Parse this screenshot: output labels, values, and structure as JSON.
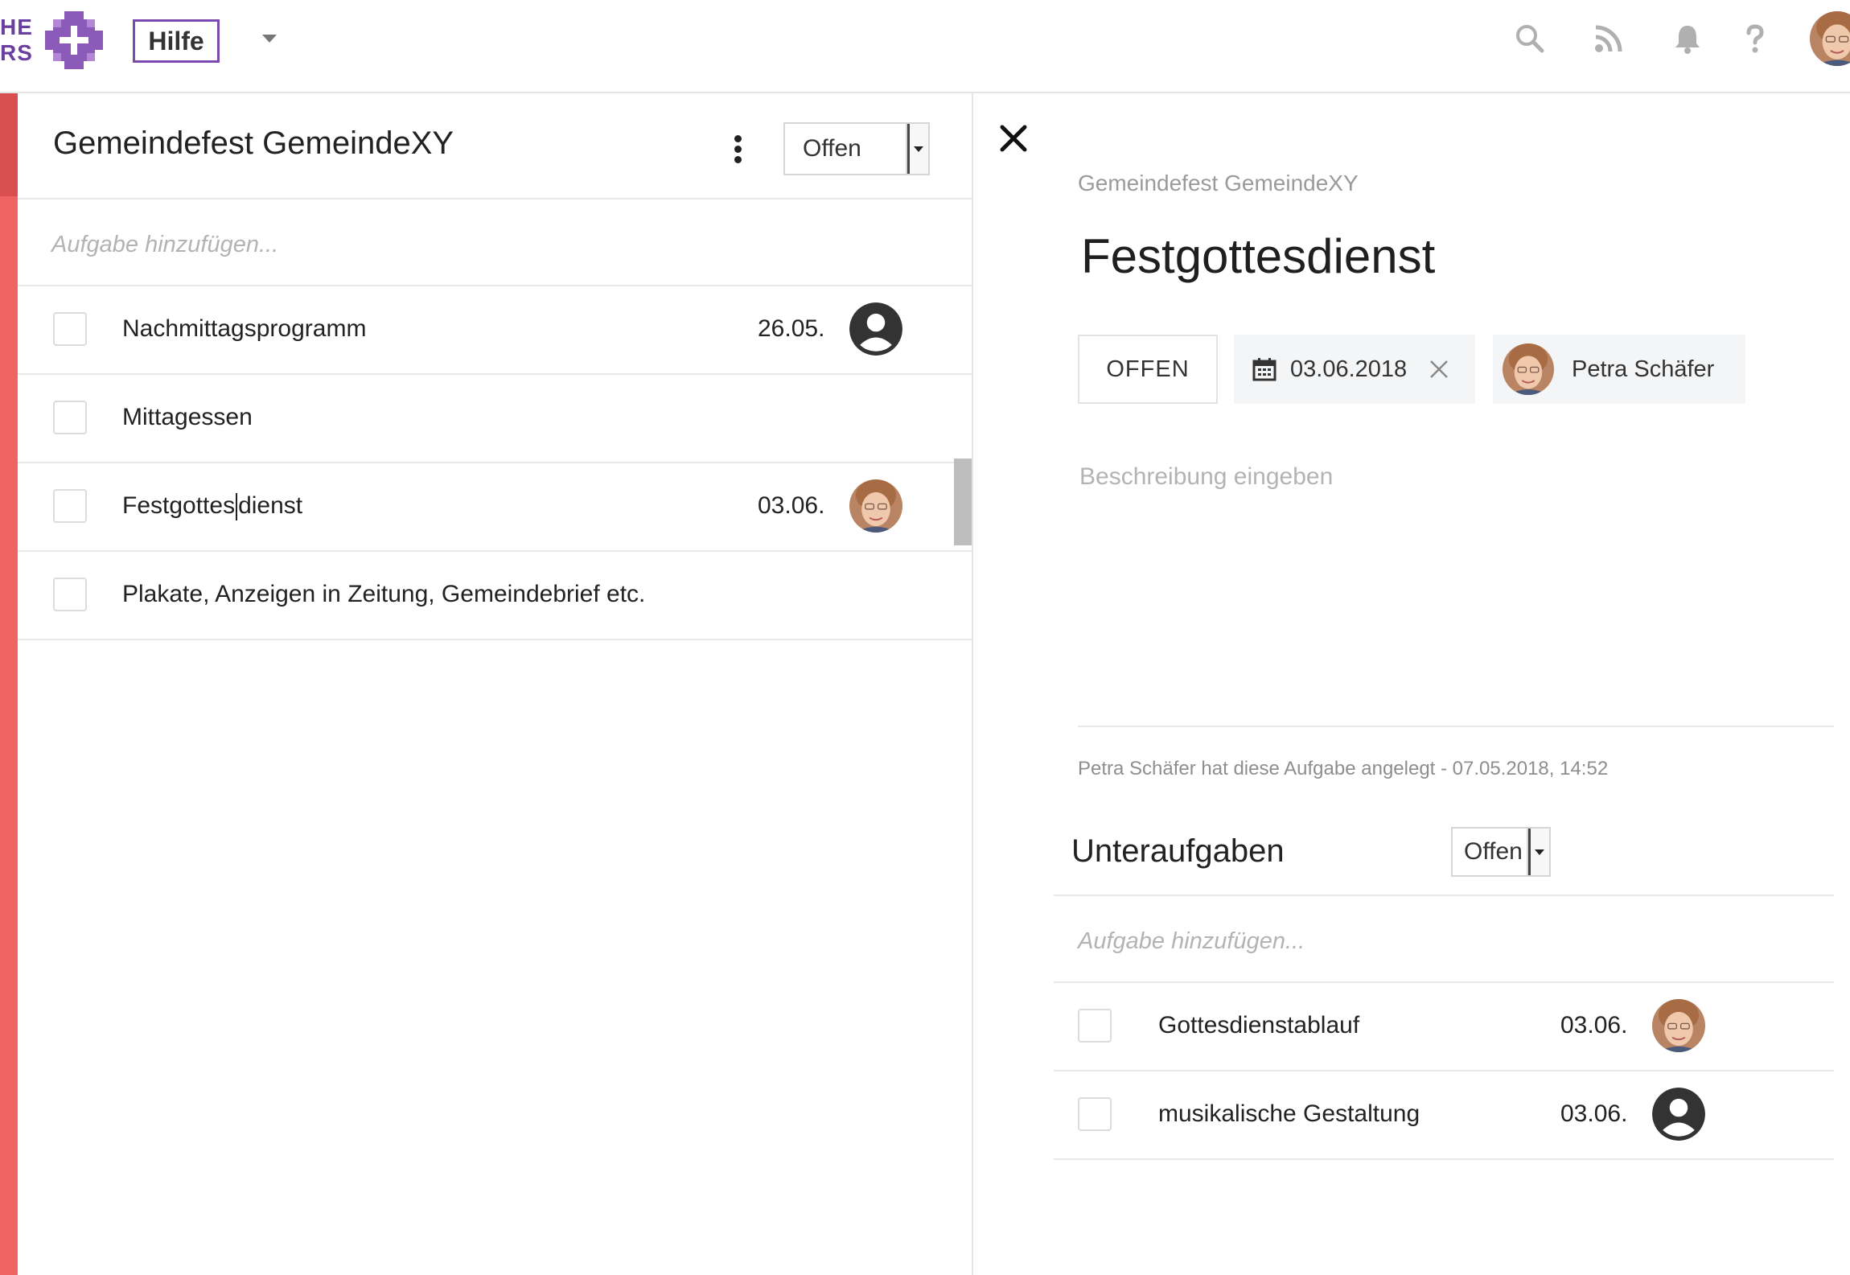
{
  "header": {
    "logo_line1": "HE",
    "logo_line2": "RS",
    "help_button": "Hilfe",
    "icons": [
      "search-icon",
      "rss-icon",
      "bell-icon",
      "help-icon"
    ],
    "brand_color": "#6a3fa0",
    "accent_color": "#f06363"
  },
  "list": {
    "title": "Gemeindefest GemeindeXY",
    "filter": "Offen",
    "add_placeholder": "Aufgabe hinzufügen...",
    "tasks": [
      {
        "label": "Nachmittagsprogramm",
        "date": "26.05.",
        "assignee": "placeholder-avatar"
      },
      {
        "label": "Mittagessen",
        "date": "",
        "assignee": ""
      },
      {
        "label_before_cursor": "Festgottes",
        "label_after_cursor": "dienst",
        "date": "03.06.",
        "assignee": "photo-avatar"
      },
      {
        "label": "Plakate, Anzeigen in Zeitung, Gemeindebrief etc.",
        "date": "",
        "assignee": ""
      }
    ]
  },
  "detail": {
    "breadcrumb": "Gemeindefest GemeindeXY",
    "title": "Festgottesdienst",
    "status": "OFFEN",
    "due_date": "03.06.2018",
    "assignee": "Petra Schäfer",
    "description_placeholder": "Beschreibung eingeben",
    "meta": "Petra Schäfer hat diese Aufgabe angelegt - 07.05.2018, 14:52",
    "subtasks": {
      "title": "Unteraufgaben",
      "filter": "Offen",
      "add_placeholder": "Aufgabe hinzufügen...",
      "items": [
        {
          "label": "Gottesdienstablauf",
          "date": "03.06.",
          "assignee": "photo-avatar"
        },
        {
          "label": "musikalische Gestaltung",
          "date": "03.06.",
          "assignee": "placeholder-avatar"
        }
      ]
    }
  }
}
